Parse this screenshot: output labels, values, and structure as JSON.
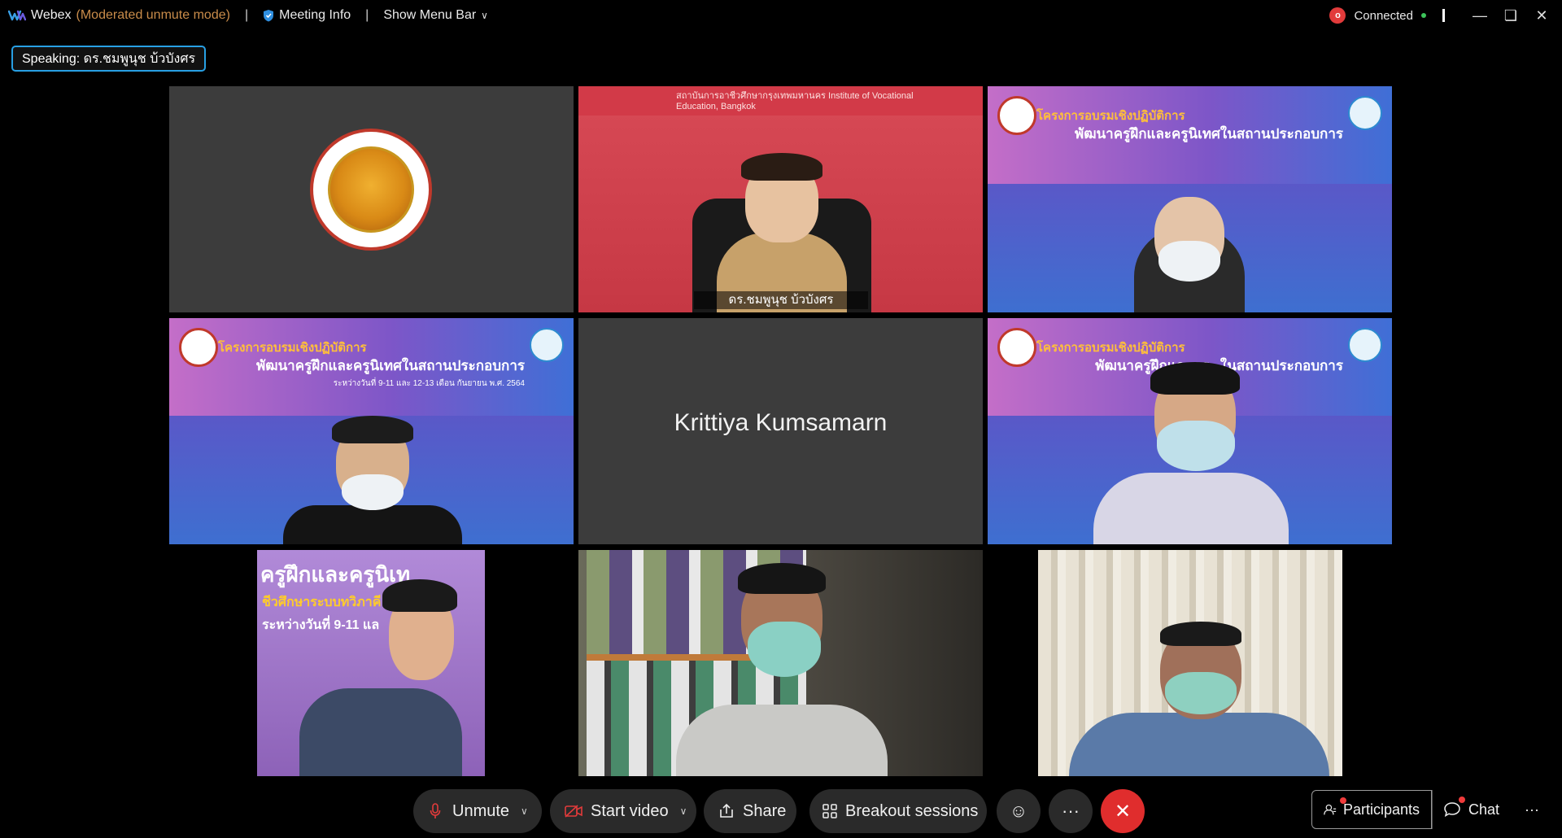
{
  "topbar": {
    "app_name": "Webex",
    "mode": "(Moderated unmute mode)",
    "meeting_info": "Meeting Info",
    "show_menu_bar": "Show Menu Bar",
    "connection_status": "Connected",
    "recording_badge": "o",
    "brand_color": "#17a8e6"
  },
  "speaking": {
    "label": "Speaking: ดร.ชมพูนุช บ้วบังศร"
  },
  "tiles": [
    {
      "type": "logo",
      "name": ""
    },
    {
      "type": "video",
      "name": "ดร.ชมพูนุช บ้วบังศร",
      "active": true,
      "header_text": "สถาบันการอาชีวศึกษากรุงเทพมหานคร Institute of Vocational Education, Bangkok"
    },
    {
      "type": "video",
      "name": "",
      "banner_title": "โครงการอบรมเชิงปฏิบัติการ",
      "banner_subtitle": "พัฒนาครูฝึกและครูนิเทศในสถานประกอบการ"
    },
    {
      "type": "video",
      "name": "",
      "banner_title": "โครงการอบรมเชิงปฏิบัติการ",
      "banner_subtitle": "พัฒนาครูฝึกและครูนิเทศในสถานประกอบการ",
      "banner_dates": "ระหว่างวันที่ 9-11 และ 12-13 เดือน กันยายน พ.ศ. 2564"
    },
    {
      "type": "name-only",
      "name": "Krittiya Kumsamarn"
    },
    {
      "type": "video",
      "name": "",
      "banner_title": "โครงการอบรมเชิงปฏิบัติการ",
      "banner_subtitle": "พัฒนาครูฝึกและครู...ในสถานประกอบการ"
    },
    {
      "type": "video",
      "name": "",
      "overlay_lines": [
        "ครูฝึกและครูนิเท",
        "ชีวศึกษาระบบทวิภาคี",
        "ระหว่างวันที่ 9-11 แล"
      ]
    },
    {
      "type": "video",
      "name": ""
    },
    {
      "type": "video",
      "name": ""
    }
  ],
  "controls": {
    "unmute": "Unmute",
    "start_video": "Start video",
    "share": "Share",
    "breakout": "Breakout sessions",
    "participants": "Participants",
    "chat": "Chat",
    "more": "···",
    "leave_color": "#e02d2d"
  }
}
